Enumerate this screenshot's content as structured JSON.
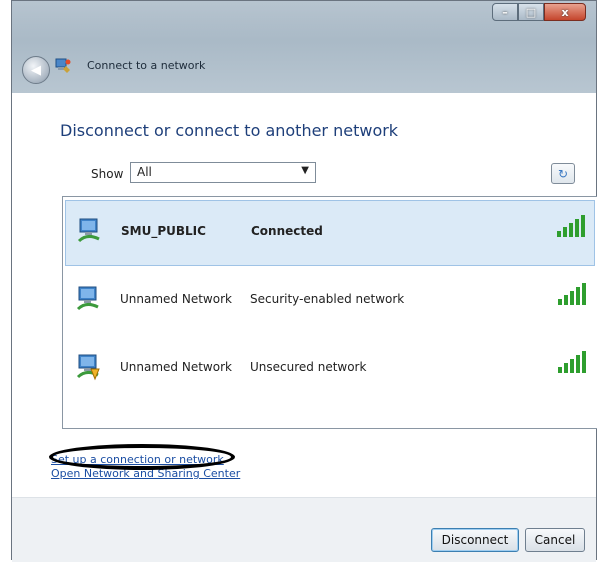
{
  "window": {
    "title": "Connect to a network",
    "controls": {
      "minimize": "–",
      "maximize": "□",
      "close": "x"
    }
  },
  "heading": "Disconnect or connect to another network",
  "filter": {
    "label": "Show",
    "selected": "All"
  },
  "networks": [
    {
      "name": "SMU_PUBLIC",
      "status": "Connected",
      "selected": true
    },
    {
      "name": "Unnamed Network",
      "status": "Security-enabled network",
      "selected": false
    },
    {
      "name": "Unnamed Network",
      "status": "Unsecured network",
      "selected": false
    }
  ],
  "links": {
    "setup": "Set up a connection or network",
    "sharing_center": "Open Network and Sharing Center"
  },
  "buttons": {
    "disconnect": "Disconnect",
    "cancel": "Cancel"
  },
  "colors": {
    "heading": "#1e3f7a",
    "link": "#1b4ea3",
    "signal": "#2e9e2e",
    "selection": "#dbeaf7"
  }
}
